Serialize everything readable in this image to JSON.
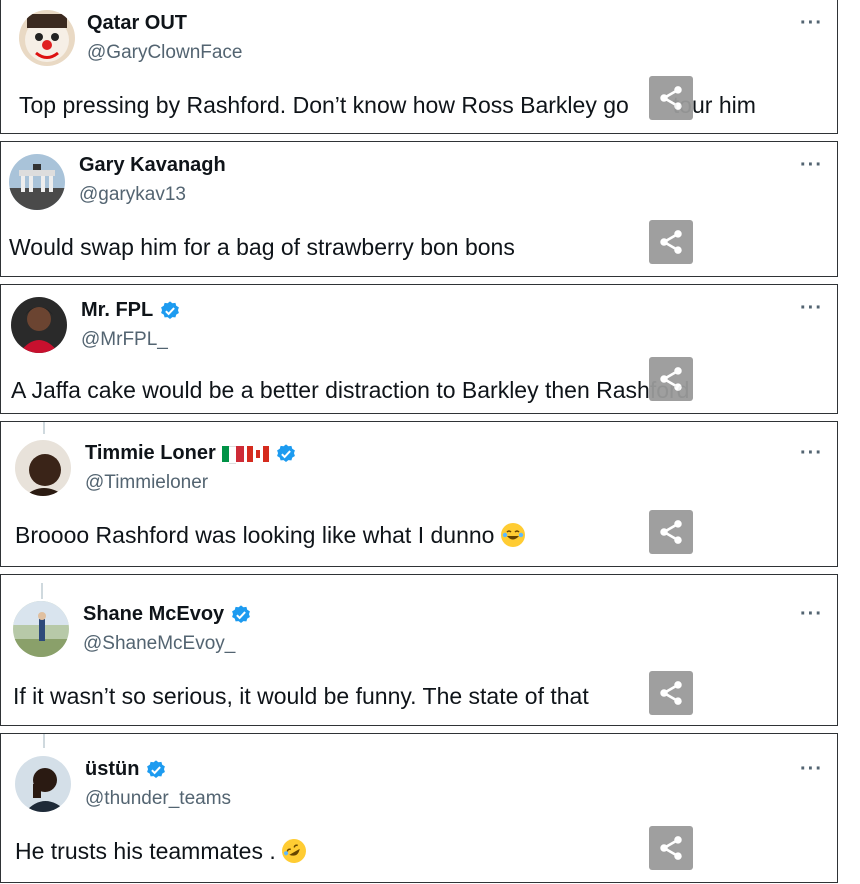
{
  "tweets": [
    {
      "name": "Qatar OUT",
      "handle": "@GaryClownFace",
      "text": "Top pressing by Rashford. Don’t know how Ross Barkley go",
      "text_tail": "tour him",
      "verified": false,
      "avatar": "clown-face-avatar",
      "more_label": "···"
    },
    {
      "name": "Gary Kavanagh",
      "handle": "@garykav13",
      "text": "Would swap him for a bag of strawberry bon bons",
      "verified": false,
      "avatar": "landmark-gate-avatar",
      "more_label": "···"
    },
    {
      "name": "Mr. FPL",
      "handle": "@MrFPL_",
      "text": "A Jaffa cake would be a better distraction to Barkley then Rashford",
      "verified": true,
      "avatar": "player-avatar",
      "more_label": "···"
    },
    {
      "name": "Timmie Loner",
      "handle": "@Timmieloner",
      "text": "Broooo Rashford was looking like what I dunno",
      "verified": true,
      "flags": [
        "italy-flag",
        "canada-flag"
      ],
      "emoji": "tears-of-joy-emoji",
      "avatar": "profile-avatar",
      "more_label": "···"
    },
    {
      "name": "Shane McEvoy",
      "handle": "@ShaneMcEvoy_",
      "text": "If it wasn’t so serious, it would be funny. The state of that",
      "verified": true,
      "avatar": "outdoor-person-avatar",
      "more_label": "···"
    },
    {
      "name": "üstün",
      "handle": "@thunder_teams",
      "text": "He trusts his teammates .",
      "verified": true,
      "emoji": "rolling-laughing-emoji",
      "avatar": "thinking-person-avatar",
      "more_label": "···"
    }
  ],
  "colors": {
    "verified": "#1d9bf0",
    "handle": "#536471",
    "border": "#2f3336",
    "share_bg": "#9a9a9a"
  },
  "icons": {
    "share": "share-icon",
    "more": "more-options-icon",
    "verified": "verified-badge-icon"
  }
}
